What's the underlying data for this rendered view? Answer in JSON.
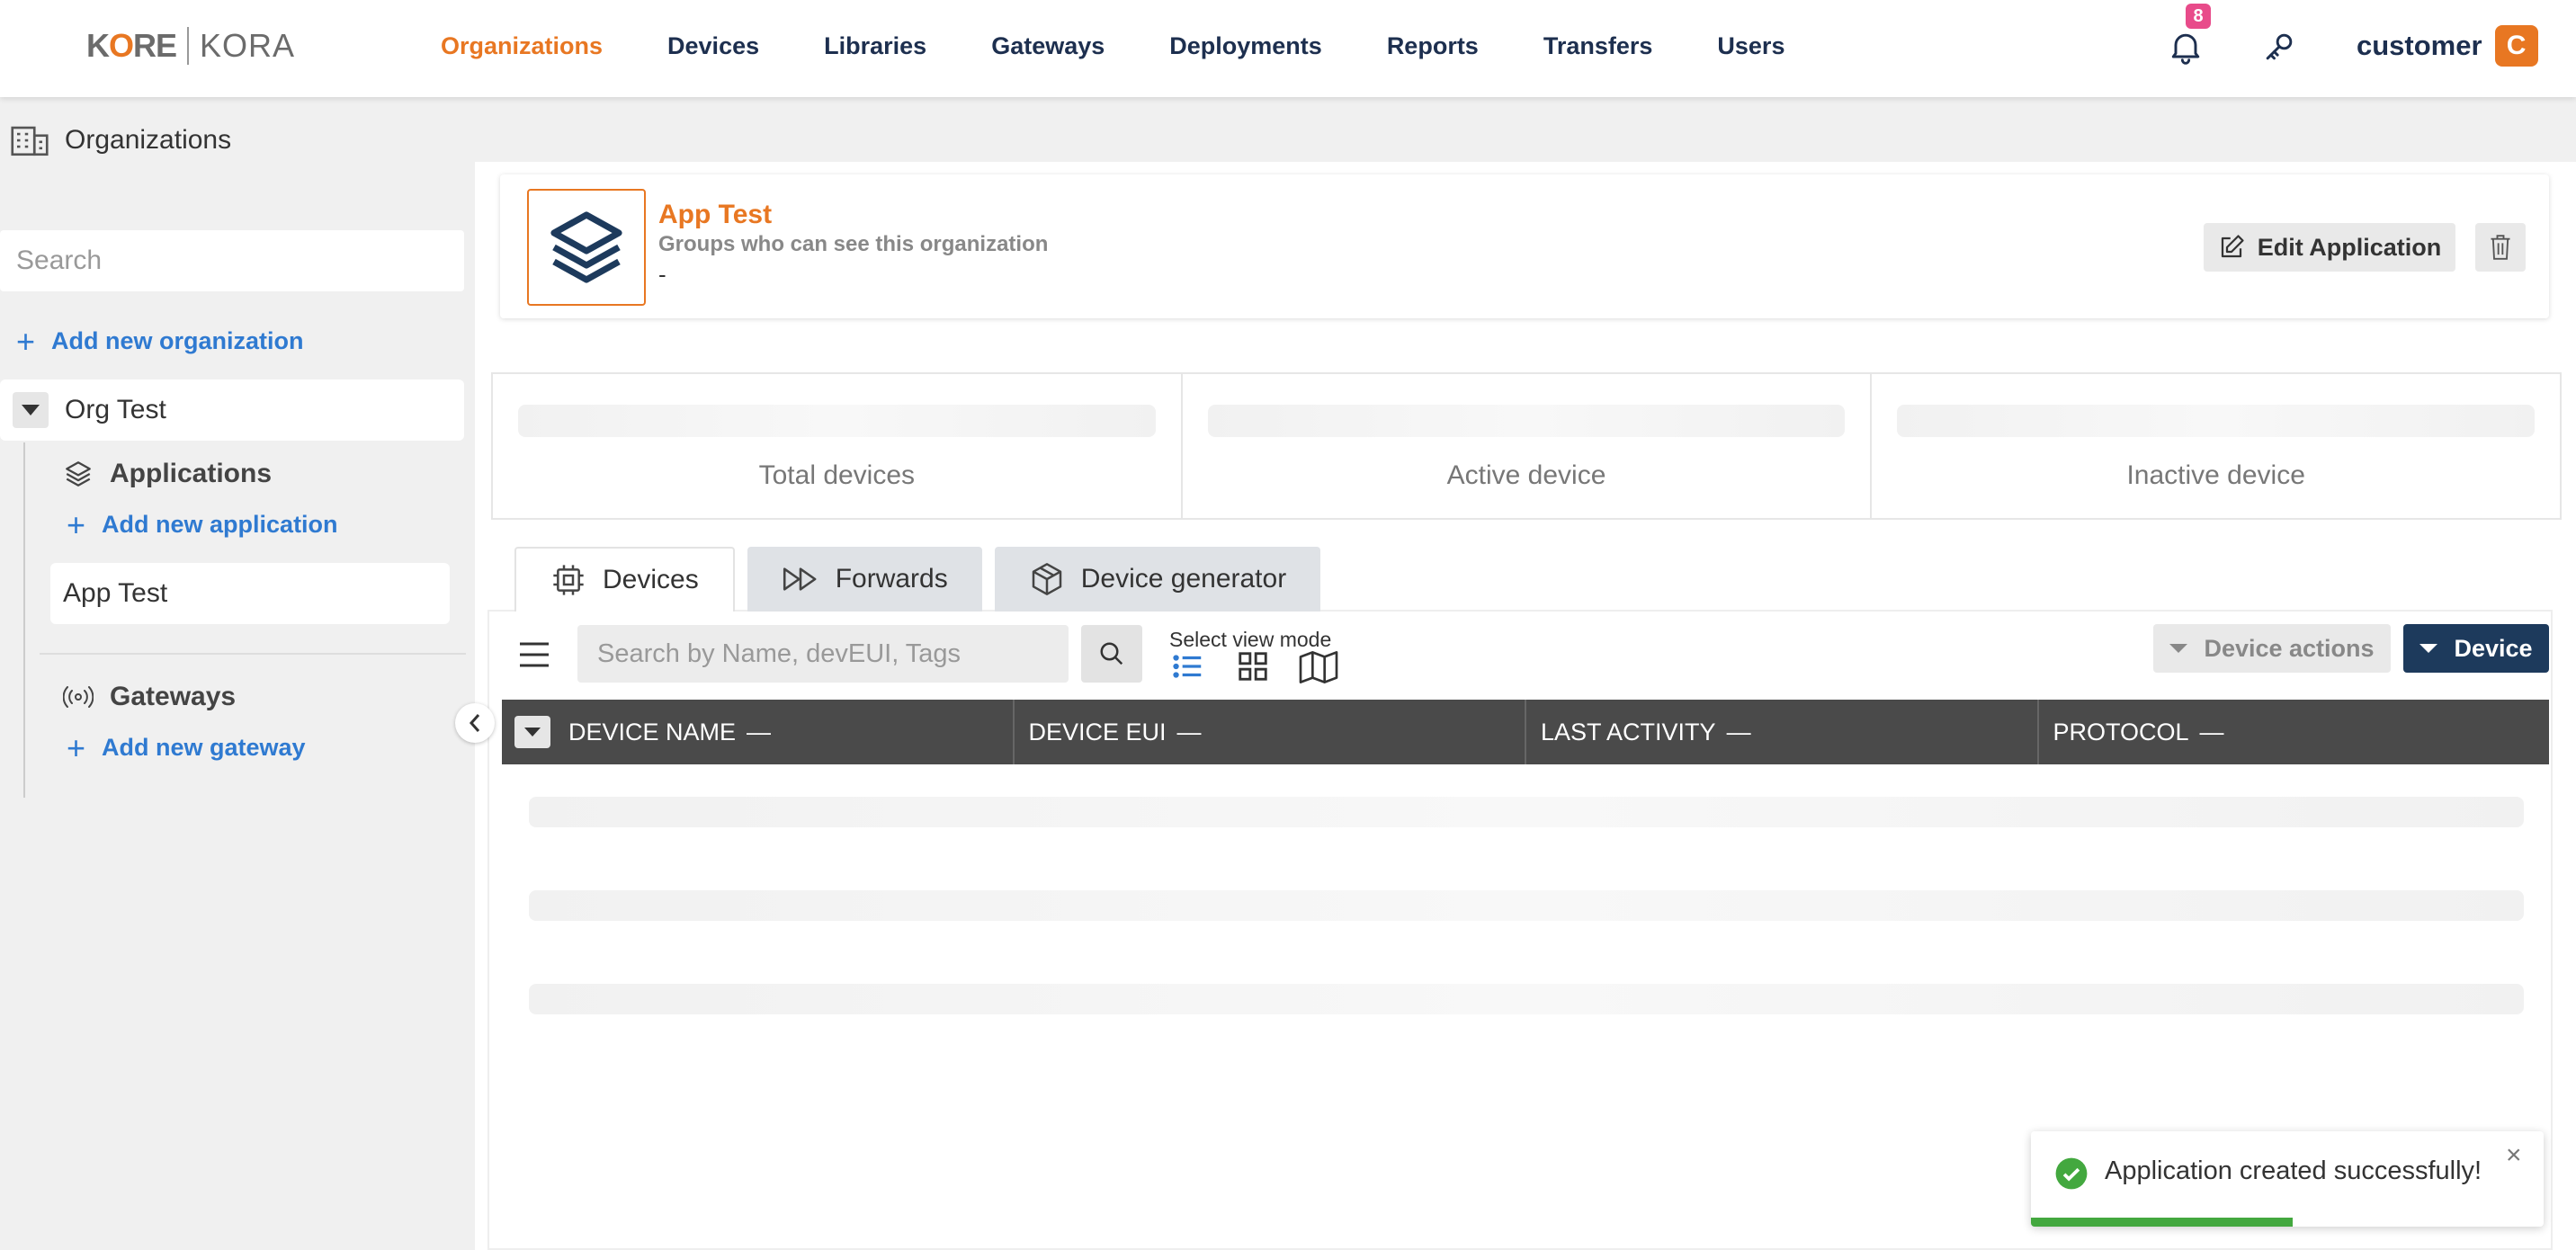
{
  "brand": {
    "left": "KORE",
    "right": "KORA",
    "accent": "#e87722",
    "navy": "#1d2f4f"
  },
  "nav": {
    "items": [
      {
        "label": "Organizations",
        "active": true
      },
      {
        "label": "Devices",
        "active": false
      },
      {
        "label": "Libraries",
        "active": false
      },
      {
        "label": "Gateways",
        "active": false
      },
      {
        "label": "Deployments",
        "active": false
      },
      {
        "label": "Reports",
        "active": false
      },
      {
        "label": "Transfers",
        "active": false
      },
      {
        "label": "Users",
        "active": false
      }
    ],
    "notifications_count": "8",
    "username": "customer",
    "avatar_letter": "C",
    "icons": [
      "bell-icon",
      "key-icon"
    ]
  },
  "sidebar": {
    "title": "Organizations",
    "search_placeholder": "Search",
    "add_org": "Add new organization",
    "org_name": "Org Test",
    "applications_title": "Applications",
    "add_app": "Add new application",
    "app_name": "App Test",
    "gateways_title": "Gateways",
    "add_gateway": "Add new gateway"
  },
  "app_card": {
    "name": "App Test",
    "subtitle": "Groups who can see this organization",
    "groups": "-",
    "edit_label": "Edit Application"
  },
  "stats": [
    {
      "label": "Total devices"
    },
    {
      "label": "Active device"
    },
    {
      "label": "Inactive device"
    }
  ],
  "tabs": [
    {
      "label": "Devices",
      "active": true,
      "icon": "chip-icon"
    },
    {
      "label": "Forwards",
      "active": false,
      "icon": "fast-forward-icon"
    },
    {
      "label": "Device generator",
      "active": false,
      "icon": "cube-icon"
    }
  ],
  "toolbar": {
    "search_placeholder": "Search by Name, devEUI, Tags",
    "view_mode_label": "Select view mode",
    "device_actions": "Device actions",
    "device_button": "Device"
  },
  "table": {
    "columns": [
      "DEVICE NAME",
      "DEVICE EUI",
      "LAST ACTIVITY",
      "PROTOCOL"
    ],
    "sort_marker": "—"
  },
  "toast": {
    "message": "Application created successfully!",
    "close": "×",
    "progress": 0.51,
    "status_color": "#43a83f"
  }
}
